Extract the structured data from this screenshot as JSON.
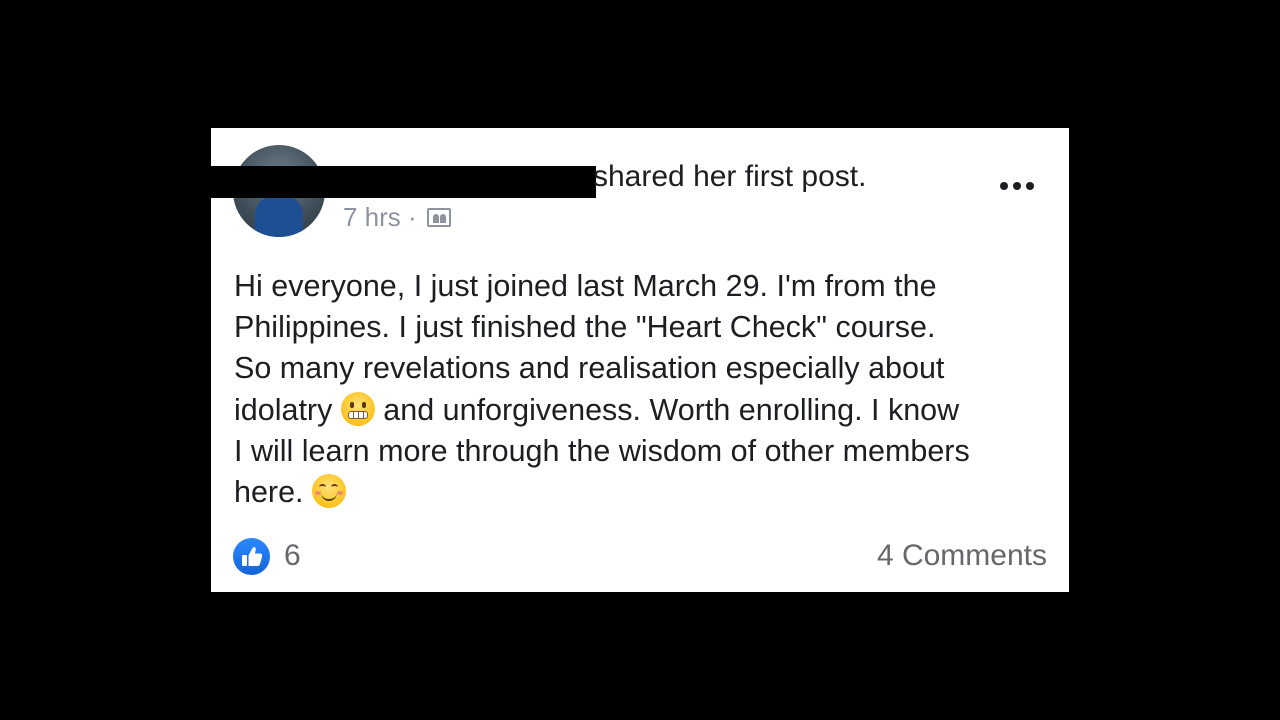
{
  "post": {
    "headline_suffix": "shared her first post.",
    "timestamp": "7 hrs ·",
    "audience_icon": "group-icon",
    "body_lines": [
      "Hi everyone, I just joined last March 29. I'm from the",
      "Philippines. I just finished the \"Heart Check\" course.",
      "So many revelations and realisation especially about",
      "idolatry",
      "and unforgiveness. Worth enrolling. I know",
      "I will learn more through the wisdom of other members",
      "here."
    ],
    "emoji_1": "grimacing-face-emoji",
    "emoji_2": "smiling-face-emoji",
    "more_icon": "more-options-icon"
  },
  "footer": {
    "like_icon": "like-reaction-icon",
    "like_count": "6",
    "comments_label": "4 Comments"
  },
  "colors": {
    "background": "#000000",
    "card": "#ffffff",
    "text": "#1c1e21",
    "muted": "#8d949e",
    "like_blue": "#1877f2"
  }
}
